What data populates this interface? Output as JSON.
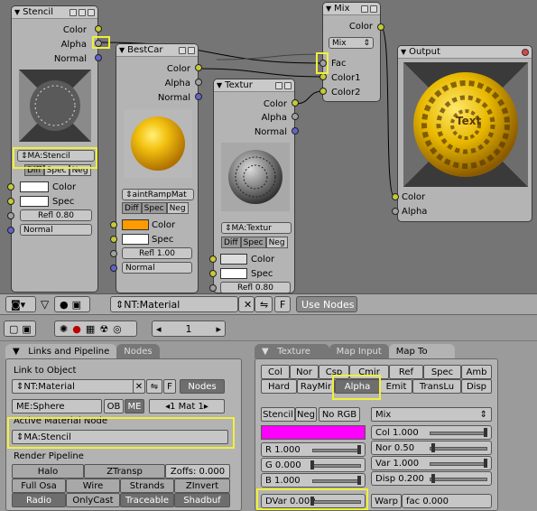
{
  "colors": {
    "highlight": "#f0f03a",
    "socket_color": "#c8c838",
    "socket_value": "#a0a0a0",
    "socket_vector": "#6464c8",
    "stencil_swatch": "#ff00ff",
    "bestcar_swatch": "#ff9a00"
  },
  "nodes": {
    "stencil": {
      "title": "Stencil",
      "outputs": [
        "Color",
        "Alpha",
        "Normal"
      ],
      "material": "MA:Stencil",
      "buttons": [
        "Diff",
        "Spec",
        "Neg"
      ],
      "inputs": [
        "Color",
        "Spec"
      ],
      "refl": "Refl 0.80",
      "normal": "Normal"
    },
    "bestcar": {
      "title": "BestCar",
      "outputs": [
        "Color",
        "Alpha",
        "Normal"
      ],
      "material": "aintRampMat",
      "buttons": [
        "Diff",
        "Spec",
        "Neg"
      ],
      "inputs": [
        "Color",
        "Spec"
      ],
      "refl": "Refl 1.00",
      "normal": "Normal"
    },
    "textur": {
      "title": "Textur",
      "outputs": [
        "Color",
        "Alpha",
        "Normal"
      ],
      "material": "MA:Textur",
      "buttons": [
        "Diff",
        "Spec",
        "Neg"
      ],
      "inputs": [
        "Color",
        "Spec"
      ],
      "refl": "Refl 0.80"
    },
    "mix": {
      "title": "Mix",
      "output": "Color",
      "mode": "Mix",
      "inputs": [
        "Fac",
        "Color1",
        "Color2"
      ]
    },
    "output": {
      "title": "Output",
      "inputs": [
        "Color",
        "Alpha"
      ],
      "sphere_text": "Text"
    }
  },
  "header": {
    "tree": "NT:Material",
    "f_label": "F",
    "use_nodes": "Use Nodes"
  },
  "toolbar2": {
    "frame": "1"
  },
  "left_panel": {
    "tabs": [
      "Links and Pipeline",
      "Nodes"
    ],
    "link_to_object": "Link to Object",
    "nt_field": "NT:Material",
    "f_label": "F",
    "nodes_btn": "Nodes",
    "me_field": "ME:Sphere",
    "ob": "OB",
    "me": "ME",
    "mat_count": "1 Mat 1",
    "active_node_label": "Active Material Node",
    "active_node_value": "MA:Stencil",
    "render_pipeline": "Render Pipeline",
    "pipeline_rows": [
      [
        "Halo",
        "ZTransp",
        "Zoffs: 0.000"
      ],
      [
        "Full Osa",
        "Wire",
        "Strands",
        "ZInvert"
      ],
      [
        "Radio",
        "OnlyCast",
        "Traceable",
        "Shadbuf"
      ]
    ]
  },
  "right_panel": {
    "tabs": [
      "Texture",
      "Map Input",
      "Map To"
    ],
    "mapto_row1": [
      "Col",
      "Nor",
      "Csp",
      "Cmir",
      "Ref",
      "Spec",
      "Amb"
    ],
    "mapto_row2": [
      "Hard",
      "RayMir",
      "Alpha",
      "Emit",
      "TransLu",
      "Disp"
    ],
    "stencil_row": [
      "Stencil",
      "Neg",
      "No RGB"
    ],
    "blend_mode": "Mix",
    "rgb": [
      "R 1.000",
      "G 0.000",
      "B 1.000"
    ],
    "factors": [
      "Col 1.000",
      "Nor 0.50",
      "Var 1.000",
      "Disp 0.200"
    ],
    "dvar": "DVar 0.000",
    "warp": "Warp",
    "fac": "fac 0.000"
  }
}
